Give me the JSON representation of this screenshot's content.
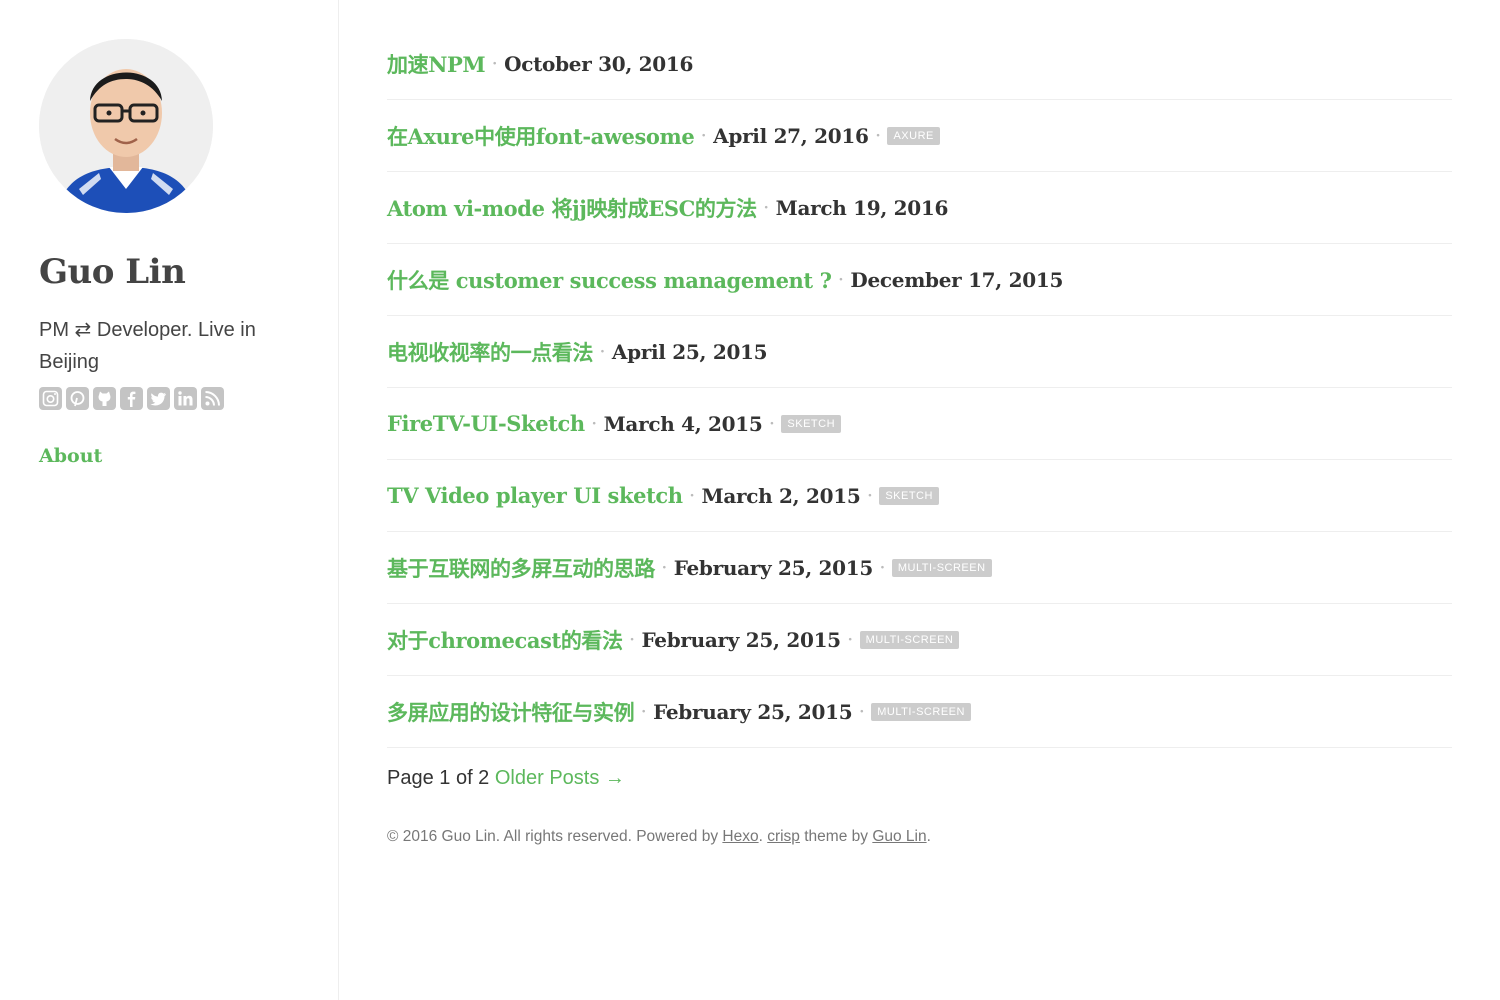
{
  "sidebar": {
    "name": "Guo Lin",
    "bio": "PM ⇄ Developer. Live in Beijing",
    "socials": [
      "instagram-icon",
      "pinterest-icon",
      "github-icon",
      "facebook-icon",
      "twitter-icon",
      "linkedin-icon",
      "rss-icon"
    ],
    "nav": {
      "about": "About"
    }
  },
  "posts": [
    {
      "title": "加速NPM",
      "date": "October 30, 2016",
      "tag": ""
    },
    {
      "title": "在Axure中使用font-awesome",
      "date": "April 27, 2016",
      "tag": "AXURE"
    },
    {
      "title": "Atom vi-mode 将jj映射成ESC的方法",
      "date": "March 19, 2016",
      "tag": ""
    },
    {
      "title": "什么是 customer success management ?",
      "date": "December 17, 2015",
      "tag": ""
    },
    {
      "title": "电视收视率的一点看法",
      "date": "April 25, 2015",
      "tag": ""
    },
    {
      "title": "FireTV-UI-Sketch",
      "date": "March 4, 2015",
      "tag": "SKETCH"
    },
    {
      "title": "TV Video player UI sketch",
      "date": "March 2, 2015",
      "tag": "SKETCH"
    },
    {
      "title": "基于互联网的多屏互动的思路",
      "date": "February 25, 2015",
      "tag": "MULTI-SCREEN"
    },
    {
      "title": "对于chromecast的看法",
      "date": "February 25, 2015",
      "tag": "MULTI-SCREEN"
    },
    {
      "title": "多屏应用的设计特征与实例",
      "date": "February 25, 2015",
      "tag": "MULTI-SCREEN"
    }
  ],
  "separator": "·",
  "pagination": {
    "text": "Page 1 of 2",
    "older": "Older Posts →"
  },
  "footer": {
    "copyright": "© 2016 Guo Lin. All rights reserved. Powered by",
    "hexo": "Hexo",
    "sep": ".",
    "crisp": "crisp",
    "theme_by": "theme by",
    "author": "Guo Lin",
    "end": "."
  },
  "colors": {
    "accent": "#5cb85c",
    "text": "#333333",
    "tag_bg": "#cccccc",
    "icon": "#c4c4c4"
  }
}
